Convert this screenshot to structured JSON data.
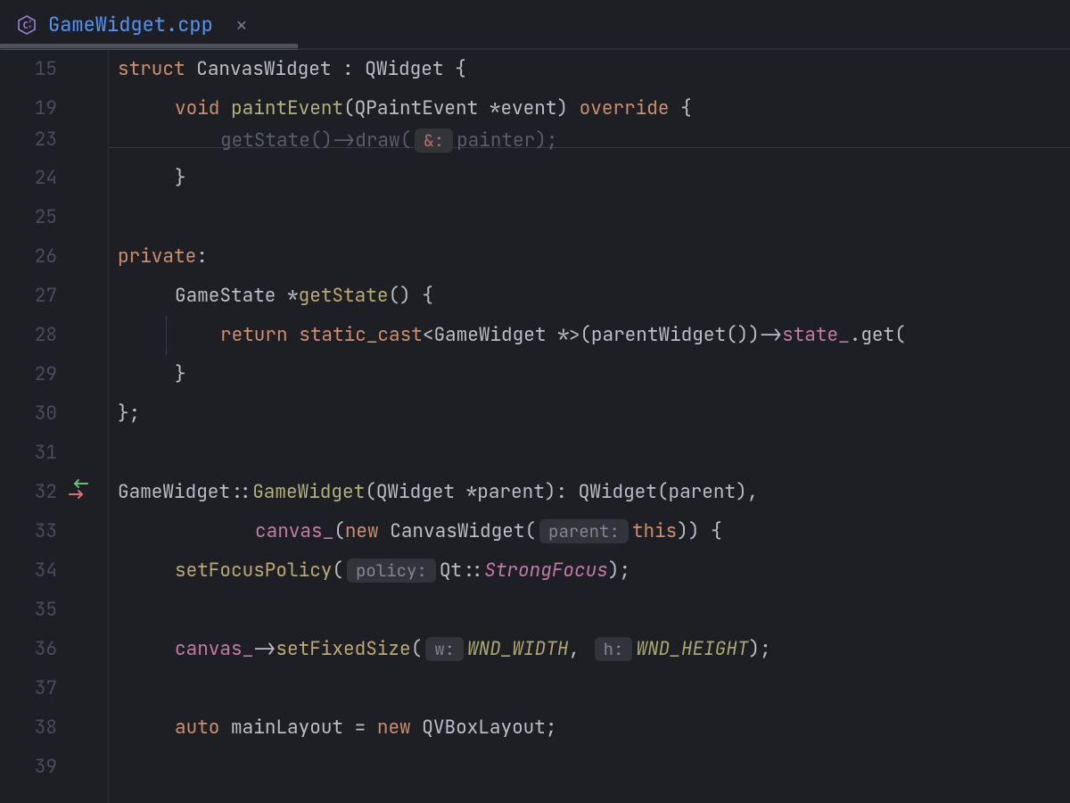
{
  "tab": {
    "filename": "GameWidget.cpp"
  },
  "gutter": {
    "numbers": [
      "15",
      "19",
      "23",
      "24",
      "25",
      "26",
      "27",
      "28",
      "29",
      "30",
      "31",
      "32",
      "33",
      "34",
      "35",
      "36",
      "37",
      "38",
      "39"
    ],
    "recursive_arrow_on": "32"
  },
  "code": {
    "l15": {
      "kw_struct": "struct",
      "name": "CanvasWidget",
      "colon": ":",
      "base": "QWidget",
      "brace": "{"
    },
    "l19": {
      "kw_void": "void",
      "fn": "paintEvent",
      "lp": "(",
      "ptype": "QPaintEvent",
      "star": "*",
      "pnam": "event",
      "rp": ")",
      "kw_ovr": "override",
      "brace": "{"
    },
    "l23": {
      "call": "getState",
      "lp": "(",
      "rp": ")",
      "arrow": "->",
      "draw": "draw",
      "lp2": "(",
      "hint_amp": "&:",
      "arg": "painter",
      "rp2": ")",
      "semi": ";"
    },
    "l24": {
      "brace": "}"
    },
    "l26": {
      "kw": "private",
      "colon": ":"
    },
    "l27": {
      "type": "GameState",
      "star": "*",
      "fn": "getState",
      "lp": "(",
      "rp": ")",
      "brace": "{"
    },
    "l28": {
      "kw_ret": "return",
      "kw_sc": "static_cast",
      "lt": "<",
      "ctype": "GameWidget",
      "star": "*",
      "gt": ">",
      "lp": "(",
      "call": "parentWidget",
      "lp2": "(",
      "rp2": ")",
      "rp": ")",
      "arrow": "->",
      "field": "state_",
      "dot": ".",
      "get": "get"
    },
    "l29": {
      "brace": "}"
    },
    "l30": {
      "brace": "};"
    },
    "l32": {
      "cls": "GameWidget",
      "scope": "::",
      "ctor": "GameWidget",
      "lp": "(",
      "ptype": "QWidget",
      "star": "*",
      "pnam": "parent",
      "rp": ")",
      "colon": ":",
      "base": "QWidget",
      "lp2": "(",
      "arg": "parent",
      "rp2": ")",
      "comma": ","
    },
    "l33": {
      "field": "canvas_",
      "lp": "(",
      "kw_new": "new",
      "type": "CanvasWidget",
      "lp2": "(",
      "hint": "parent:",
      "arg": "this",
      "rp2": ")",
      "rp": ")",
      "brace": "{"
    },
    "l34": {
      "call": "setFocusPolicy",
      "lp": "(",
      "hint": "policy:",
      "ns": "Qt",
      "scope": "::",
      "enum": "StrongFocus",
      "rp": ")",
      "semi": ";"
    },
    "l36": {
      "field": "canvas_",
      "arrow": "->",
      "call": "setFixedSize",
      "lp": "(",
      "h1": "w:",
      "a1": "WND_WIDTH",
      "comma": ",",
      "h2": "h:",
      "a2": "WND_HEIGHT",
      "rp": ")",
      "semi": ";"
    },
    "l38": {
      "kw_auto": "auto",
      "var": "mainLayout",
      "eq": "=",
      "kw_new": "new",
      "type": "QVBoxLayout",
      "semi": ";"
    }
  }
}
